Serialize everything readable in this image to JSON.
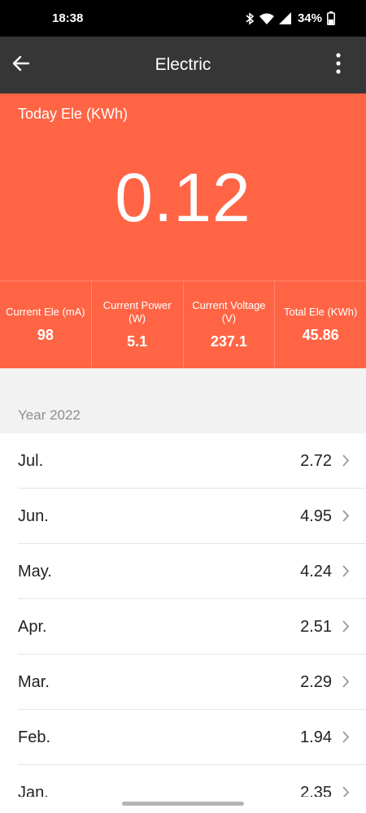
{
  "status_bar": {
    "time": "18:38",
    "battery": "34%"
  },
  "app_bar": {
    "title": "Electric",
    "back_icon": "arrow-left-icon",
    "menu_icon": "more-vertical-icon"
  },
  "hero": {
    "label": "Today Ele (KWh)",
    "value": "0.12"
  },
  "stats": [
    {
      "label": "Current Ele (mA)",
      "value": "98"
    },
    {
      "label": "Current Power (W)",
      "value": "5.1"
    },
    {
      "label": "Current Voltage (V)",
      "value": "237.1"
    },
    {
      "label": "Total Ele (KWh)",
      "value": "45.86"
    }
  ],
  "section": {
    "year_label": "Year 2022"
  },
  "months": [
    {
      "month": "Jul.",
      "value": "2.72"
    },
    {
      "month": "Jun.",
      "value": "4.95"
    },
    {
      "month": "May.",
      "value": "4.24"
    },
    {
      "month": "Apr.",
      "value": "2.51"
    },
    {
      "month": "Mar.",
      "value": "2.29"
    },
    {
      "month": "Feb.",
      "value": "1.94"
    },
    {
      "month": "Jan.",
      "value": "2.35"
    }
  ],
  "colors": {
    "accent": "#ff6545",
    "app_bar": "#363636",
    "status_bar": "#000000"
  }
}
